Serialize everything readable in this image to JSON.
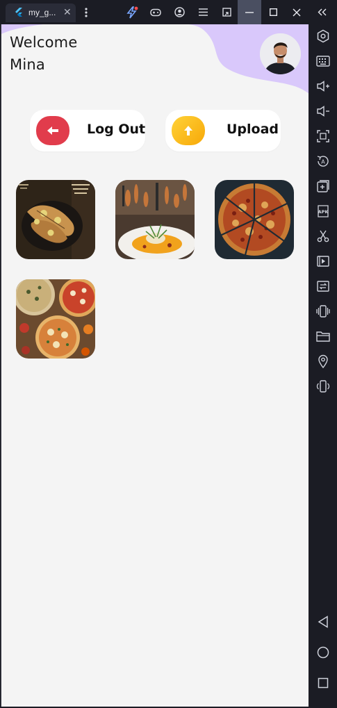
{
  "window": {
    "tab_title": "my_g...",
    "tab_close": "✕"
  },
  "titlebar_icons": [
    "flutter-bolt-icon",
    "gamepad-icon",
    "account-icon",
    "menu-icon",
    "resize-icon",
    "minimize-icon",
    "maximize-icon",
    "close-icon",
    "collapse-icon"
  ],
  "sidebar_icons": [
    "settings-hex-icon",
    "keyboard-icon",
    "volume-up-icon",
    "volume-down-icon",
    "screenshot-icon",
    "rotate-icon",
    "add-app-icon",
    "apk-icon",
    "scissors-icon",
    "video-icon",
    "transfer-icon",
    "shake-icon",
    "folder-icon",
    "location-icon",
    "vibrate-icon",
    "back-icon",
    "home-icon",
    "recents-icon"
  ],
  "header": {
    "greeting": "Welcome",
    "user_name": "Mina"
  },
  "actions": {
    "logout_label": "Log Out",
    "upload_label": "Upload"
  },
  "gallery": {
    "items": [
      "fried-fish-photo",
      "plated-dish-photo",
      "sliced-pizza-photo",
      "pizzas-table-photo"
    ]
  },
  "colors": {
    "screen_bg": "#f4f4f4",
    "blob": "#d9c8fb",
    "logout_accent": "#e13c4c",
    "upload_accent": "#fbbd1a",
    "chrome_bg": "#1b1c24"
  }
}
